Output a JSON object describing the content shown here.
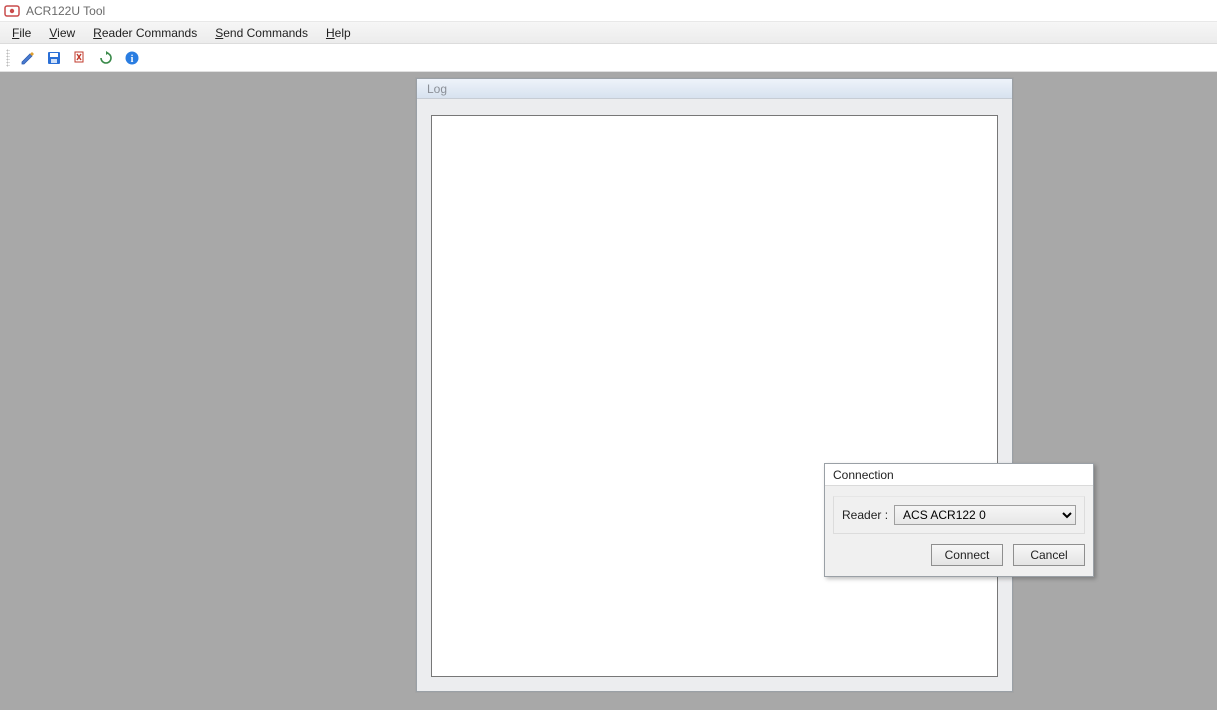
{
  "app": {
    "title": "ACR122U Tool"
  },
  "menu": {
    "file": "File",
    "view": "View",
    "reader_commands": "Reader Commands",
    "send_commands": "Send Commands",
    "help": "Help"
  },
  "toolbar_icons": {
    "edit": "edit-icon",
    "save": "save-icon",
    "clear": "clear-icon",
    "refresh": "refresh-icon",
    "info": "info-icon"
  },
  "log_panel": {
    "title": "Log",
    "content": ""
  },
  "connection_dialog": {
    "title": "Connection",
    "reader_label": "Reader  :",
    "reader_selected": "ACS ACR122 0",
    "reader_options": [
      "ACS ACR122 0"
    ],
    "connect_label": "Connect",
    "cancel_label": "Cancel"
  }
}
